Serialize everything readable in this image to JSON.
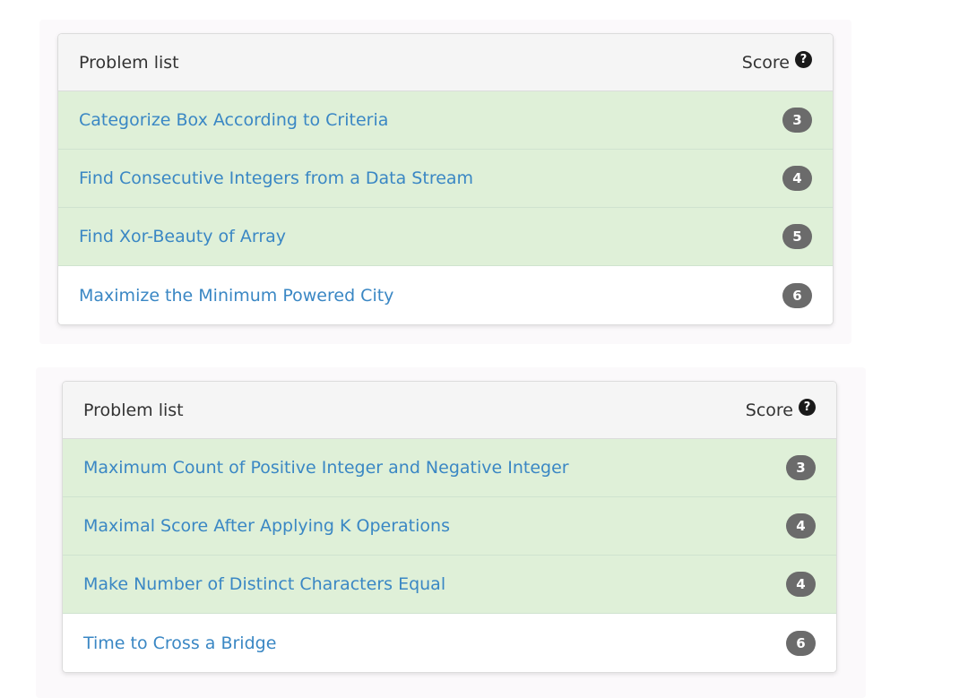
{
  "panels": [
    {
      "header": {
        "title": "Problem list",
        "score_label": "Score",
        "help_glyph": "?"
      },
      "problems": [
        {
          "title": "Categorize Box According to Criteria",
          "score": "3",
          "status": "solved"
        },
        {
          "title": "Find Consecutive Integers from a Data Stream",
          "score": "4",
          "status": "solved"
        },
        {
          "title": "Find Xor-Beauty of Array",
          "score": "5",
          "status": "solved"
        },
        {
          "title": "Maximize the Minimum Powered City",
          "score": "6",
          "status": "unsolved"
        }
      ]
    },
    {
      "header": {
        "title": "Problem list",
        "score_label": "Score",
        "help_glyph": "?"
      },
      "problems": [
        {
          "title": "Maximum Count of Positive Integer and Negative Integer",
          "score": "3",
          "status": "solved"
        },
        {
          "title": "Maximal Score After Applying K Operations",
          "score": "4",
          "status": "solved"
        },
        {
          "title": "Make Number of Distinct Characters Equal",
          "score": "4",
          "status": "solved"
        },
        {
          "title": "Time to Cross a Bridge",
          "score": "6",
          "status": "unsolved"
        }
      ]
    }
  ],
  "colors": {
    "solved_row": "#dff0d8",
    "link": "#3a87c4",
    "badge": "#6b6b6b",
    "header_bg": "#f5f5f5"
  },
  "icons": {
    "help": "question-circle-icon"
  }
}
